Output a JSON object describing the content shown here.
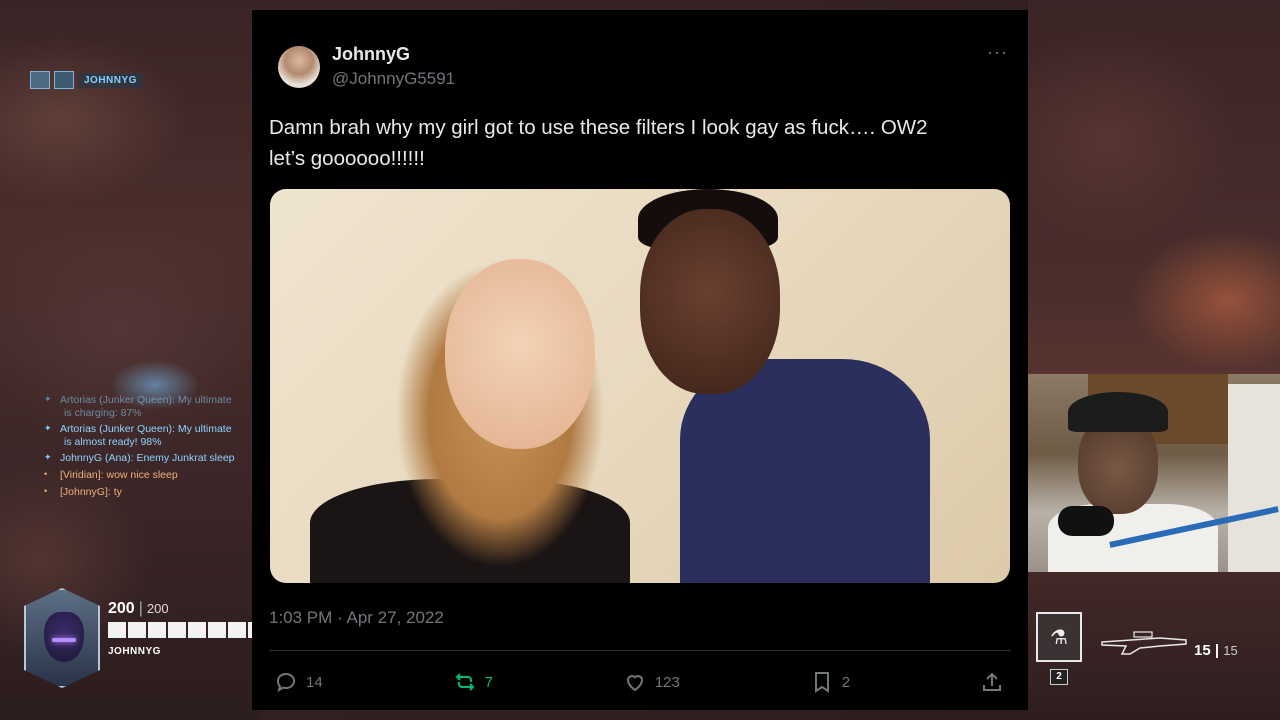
{
  "hud": {
    "team_tag": "JOHNNYG",
    "chat": [
      {
        "speaker": "Artorias",
        "text": "Artorias (Junker Queen): My ultimate",
        "sub": "is charging: 87%",
        "faded": true,
        "tone": "blue"
      },
      {
        "speaker": "Artorias",
        "text": "Artorias (Junker Queen): My ultimate",
        "sub": "is almost ready! 98%",
        "faded": false,
        "tone": "blue"
      },
      {
        "speaker": "JohnnyG",
        "text": "JohnnyG (Ana): Enemy Junkrat sleep",
        "sub": "",
        "faded": false,
        "tone": "blue"
      },
      {
        "speaker": "Viridian",
        "text": "[Viridian]: wow nice sleep",
        "sub": "",
        "faded": false,
        "tone": "orange"
      },
      {
        "speaker": "JohnnyG",
        "text": "[JohnnyG]: ty",
        "sub": "",
        "faded": false,
        "tone": "orange"
      }
    ],
    "health_current": "200",
    "health_max": "200",
    "health_segments": 8,
    "player_name": "JOHNNYG",
    "ability_key": "2",
    "ammo_current": "15",
    "ammo_max": "15"
  },
  "tweet": {
    "display_name": "JohnnyG",
    "handle": "@JohnnyG5591",
    "more_label": "···",
    "text_line1": "Damn brah why my girl got to use these filters I look gay as fuck…. OW2",
    "text_line2": "let’s goooooo!!!!!!",
    "timestamp": "1:03 PM · Apr 27, 2022",
    "replies": "14",
    "retweets": "7",
    "likes": "123",
    "bookmarks": "2"
  },
  "colors": {
    "tweet_bg": "#000000",
    "text_primary": "#e7e9ea",
    "text_secondary": "#71767b",
    "retweet_green": "#00ba7c",
    "chat_blue": "#8fd3ff",
    "chat_orange": "#f0b07a"
  }
}
